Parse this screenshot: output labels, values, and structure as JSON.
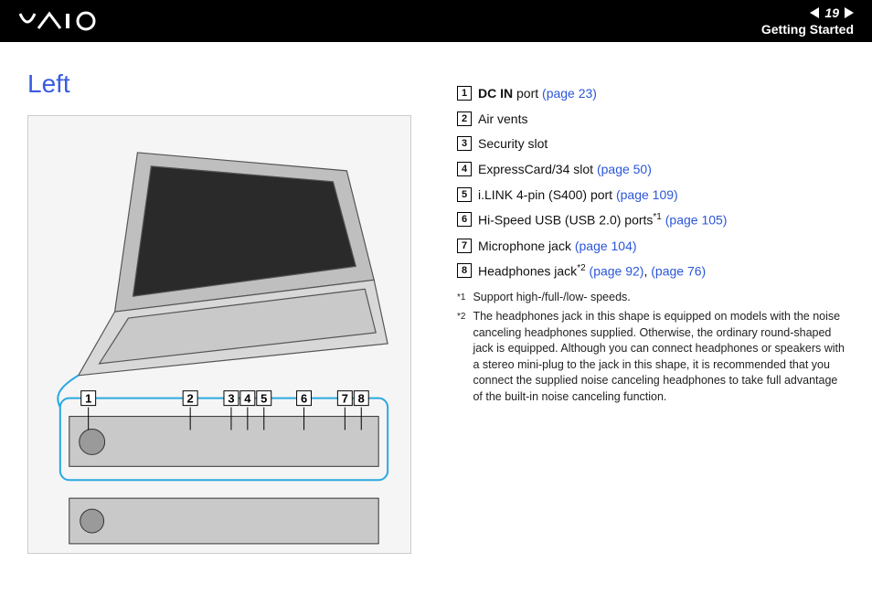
{
  "header": {
    "logo_alt": "VAIO",
    "page_number": "19",
    "section": "Getting Started"
  },
  "title": "Left",
  "figure_alt": "Illustration: laptop and left-side port callouts labeled 1–8",
  "callouts": [
    {
      "num": "1",
      "label_bold": "DC IN",
      "label_rest": " port ",
      "links": [
        "(page 23)"
      ],
      "sup": ""
    },
    {
      "num": "2",
      "label_bold": "",
      "label_rest": "Air vents",
      "links": [],
      "sup": ""
    },
    {
      "num": "3",
      "label_bold": "",
      "label_rest": "Security slot",
      "links": [],
      "sup": ""
    },
    {
      "num": "4",
      "label_bold": "",
      "label_rest": "ExpressCard/34 slot ",
      "links": [
        "(page 50)"
      ],
      "sup": ""
    },
    {
      "num": "5",
      "label_bold": "",
      "label_rest": "i.LINK 4-pin (S400) port ",
      "links": [
        "(page 109)"
      ],
      "sup": ""
    },
    {
      "num": "6",
      "label_bold": "",
      "label_rest": "Hi-Speed USB (USB 2.0) ports",
      "links": [
        "(page 105)"
      ],
      "sup": "*1"
    },
    {
      "num": "7",
      "label_bold": "",
      "label_rest": "Microphone jack ",
      "links": [
        "(page 104)"
      ],
      "sup": ""
    },
    {
      "num": "8",
      "label_bold": "",
      "label_rest": "Headphones jack",
      "links": [
        "(page 92)",
        "(page 76)"
      ],
      "sup": "*2",
      "link_sep": ", "
    }
  ],
  "footnotes": [
    {
      "mark": "*1",
      "text": "Support high-/full-/low- speeds."
    },
    {
      "mark": "*2",
      "text": "The headphones jack in this shape is equipped on models with the noise canceling headphones supplied. Otherwise, the ordinary round-shaped jack is equipped. Although you can connect headphones or speakers with a stereo mini-plug to the jack in this shape, it is recommended that you connect the supplied noise canceling headphones to take full advantage of the built-in noise canceling function."
    }
  ]
}
